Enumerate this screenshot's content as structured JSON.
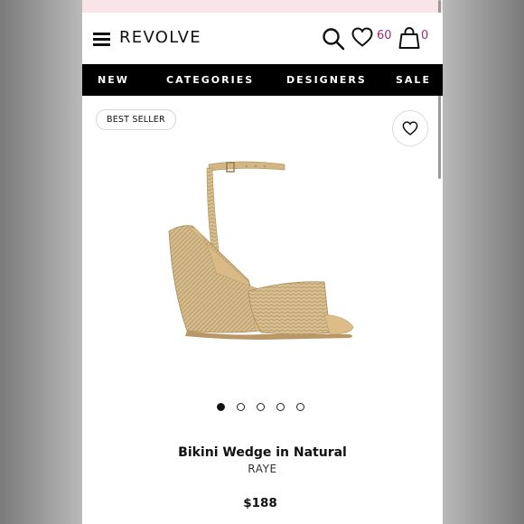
{
  "header": {
    "logo": "REVOLVE",
    "wishlist_count": "60",
    "bag_count": "0"
  },
  "nav": {
    "items": [
      {
        "label": "NEW"
      },
      {
        "label": "CATEGORIES"
      },
      {
        "label": "DESIGNERS"
      },
      {
        "label": "SALE"
      }
    ]
  },
  "product": {
    "badge": "BEST SELLER",
    "title": "Bikini Wedge in Natural",
    "brand": "RAYE",
    "price": "$188",
    "image_count": 5,
    "active_image": 1
  },
  "colors": {
    "accent_count": "#9b2c75",
    "promo_bar": "#f9e4e8",
    "nav_bg": "#000000"
  },
  "icons": [
    "menu-icon",
    "search-icon",
    "heart-icon",
    "bag-icon",
    "heart-outline-icon"
  ]
}
